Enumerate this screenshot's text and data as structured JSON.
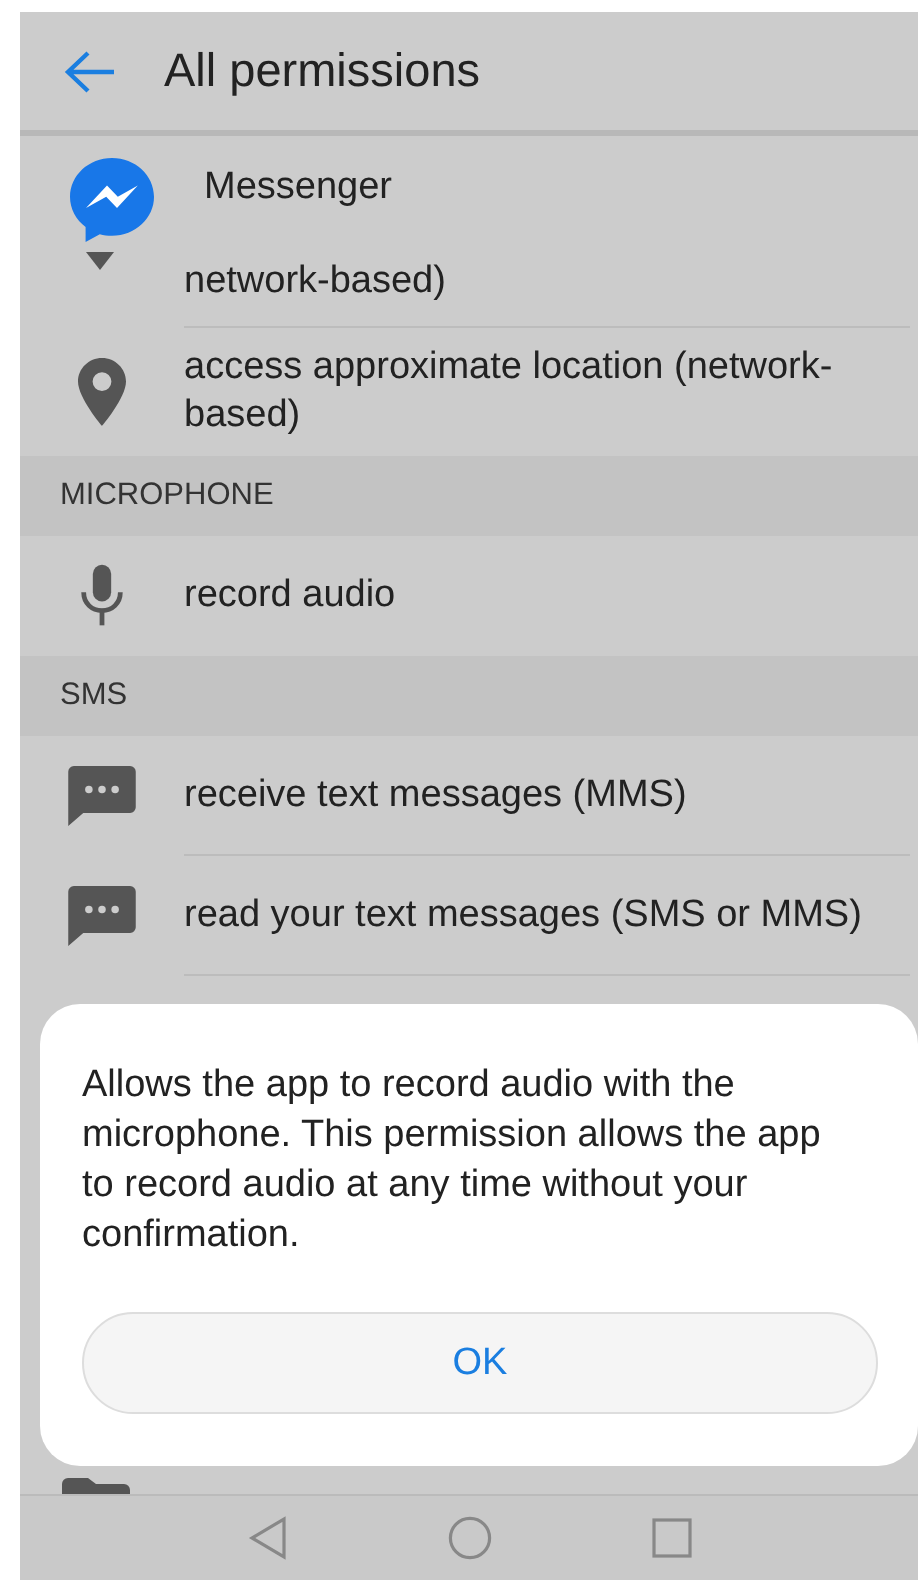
{
  "header": {
    "title": "All permissions"
  },
  "app_badge": {
    "name": "Messenger"
  },
  "groups": [
    {
      "items": [
        {
          "kind": "plain",
          "label": "network-based)"
        },
        {
          "kind": "location",
          "label": "access approximate location (network-based)"
        }
      ]
    },
    {
      "title": "MICROPHONE",
      "items": [
        {
          "kind": "mic",
          "label": "record audio"
        }
      ]
    },
    {
      "title": "SMS",
      "items": [
        {
          "kind": "sms",
          "label": "receive text messages (MMS)"
        },
        {
          "kind": "sms",
          "label": "read your text messages (SMS or MMS)"
        }
      ]
    }
  ],
  "dialog": {
    "message": "Allows the app to record audio with the microphone. This permission allows the app to record audio at any time without your confirmation.",
    "button": "OK"
  }
}
